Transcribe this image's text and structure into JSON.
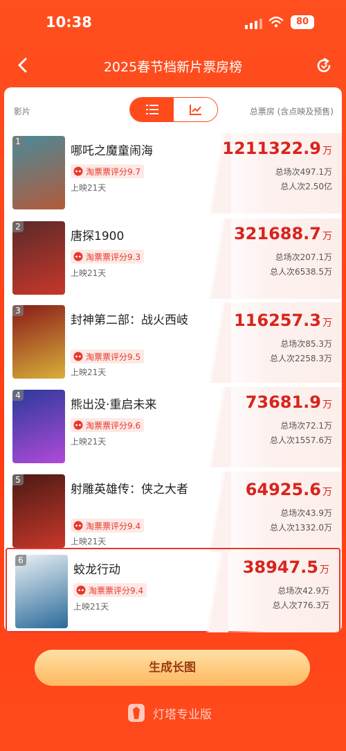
{
  "status": {
    "time": "10:38",
    "battery": "80"
  },
  "nav": {
    "title": "2025春节档新片票房榜"
  },
  "header": {
    "col_film": "影片",
    "col_total": "总票房 (含点映及预售)"
  },
  "films": [
    {
      "rank": "1",
      "title": "哪吒之魔童闹海",
      "rating": "淘票票评分9.7",
      "days": "上映21天",
      "gross": "1211322.9",
      "unit": "万",
      "sessions": "总场次497.1万",
      "people": "总人次2.50亿",
      "poster_colors": [
        "#4a8a9a",
        "#b35a3a"
      ]
    },
    {
      "rank": "2",
      "title": "唐探1900",
      "rating": "淘票票评分9.3",
      "days": "上映21天",
      "gross": "321688.7",
      "unit": "万",
      "sessions": "总场次207.1万",
      "people": "总人次6538.5万",
      "poster_colors": [
        "#5a2a2a",
        "#c8372a"
      ]
    },
    {
      "rank": "3",
      "title": "封神第二部：战火西岐",
      "rating": "淘票票评分9.5",
      "days": "上映21天",
      "gross": "116257.3",
      "unit": "万",
      "sessions": "总场次85.3万",
      "people": "总人次2258.3万",
      "poster_colors": [
        "#8a1a1a",
        "#d8b03a"
      ]
    },
    {
      "rank": "4",
      "title": "熊出没·重启未来",
      "rating": "淘票票评分9.6",
      "days": "上映21天",
      "gross": "73681.9",
      "unit": "万",
      "sessions": "总场次72.1万",
      "people": "总人次1557.6万",
      "poster_colors": [
        "#2a3a9a",
        "#b04ad8"
      ]
    },
    {
      "rank": "5",
      "title": "射雕英雄传：侠之大者",
      "rating": "淘票票评分9.4",
      "days": "上映21天",
      "gross": "64925.6",
      "unit": "万",
      "sessions": "总场次43.9万",
      "people": "总人次1332.0万",
      "poster_colors": [
        "#4a1a14",
        "#c8372a"
      ]
    },
    {
      "rank": "6",
      "title": "蛟龙行动",
      "rating": "淘票票评分9.4",
      "days": "上映21天",
      "gross": "38947.5",
      "unit": "万",
      "sessions": "总场次42.9万",
      "people": "总人次776.3万",
      "poster_colors": [
        "#eaf0f4",
        "#2a6a9a"
      ]
    }
  ],
  "actions": {
    "generate_label": "生成长图"
  },
  "brand": {
    "name": "灯塔专业版"
  }
}
